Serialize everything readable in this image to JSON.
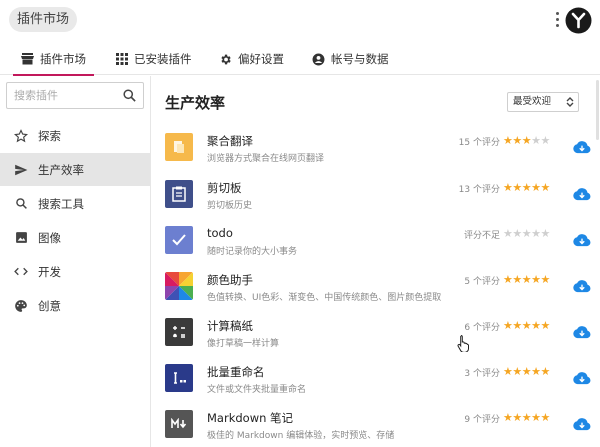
{
  "app": {
    "title": "插件市场"
  },
  "tabs": [
    {
      "label": "插件市场",
      "icon": "store-icon"
    },
    {
      "label": "已安装插件",
      "icon": "grid-icon"
    },
    {
      "label": "偏好设置",
      "icon": "gear-icon"
    },
    {
      "label": "帐号与数据",
      "icon": "account-icon"
    }
  ],
  "search": {
    "placeholder": "搜索插件",
    "value": ""
  },
  "sidebar": {
    "items": [
      {
        "label": "探索",
        "icon": "star-outline-icon"
      },
      {
        "label": "生产效率",
        "icon": "send-icon"
      },
      {
        "label": "搜索工具",
        "icon": "search-icon"
      },
      {
        "label": "图像",
        "icon": "image-icon"
      },
      {
        "label": "开发",
        "icon": "code-icon"
      },
      {
        "label": "创意",
        "icon": "palette-icon"
      }
    ]
  },
  "main": {
    "heading": "生产效率",
    "sort_label": "最受欢迎",
    "plugins": [
      {
        "name": "聚合翻译",
        "desc": "浏览器方式聚合在线网页翻译",
        "rating_text": "15 个评分",
        "stars": 3,
        "icon_color": "#f6b94b"
      },
      {
        "name": "剪切板",
        "desc": "剪切板历史",
        "rating_text": "13 个评分",
        "stars": 5,
        "icon_color": "#3f4f8a"
      },
      {
        "name": "todo",
        "desc": "随时记录你的大小事务",
        "rating_text": "评分不足",
        "stars": 0,
        "icon_color": "#6c7fd0"
      },
      {
        "name": "颜色助手",
        "desc": "色值转换、UI色彩、渐变色、中国传统颜色、图片颜色提取",
        "rating_text": "5 个评分",
        "stars": 5,
        "icon_color": "#e84a3c"
      },
      {
        "name": "计算稿纸",
        "desc": "像打草稿一样计算",
        "rating_text": "6 个评分",
        "stars": 5,
        "icon_color": "#3a3a3a"
      },
      {
        "name": "批量重命名",
        "desc": "文件或文件夹批量重命名",
        "rating_text": "3 个评分",
        "stars": 5,
        "icon_color": "#2a3a8a"
      },
      {
        "name": "Markdown 笔记",
        "desc": "极佳的 Markdown 编辑体验，实时预览、存储",
        "rating_text": "9 个评分",
        "stars": 5,
        "icon_color": "#555555"
      }
    ]
  },
  "colors": {
    "accent": "#c2185b",
    "download": "#1e88e5",
    "star": "#f5a623"
  }
}
